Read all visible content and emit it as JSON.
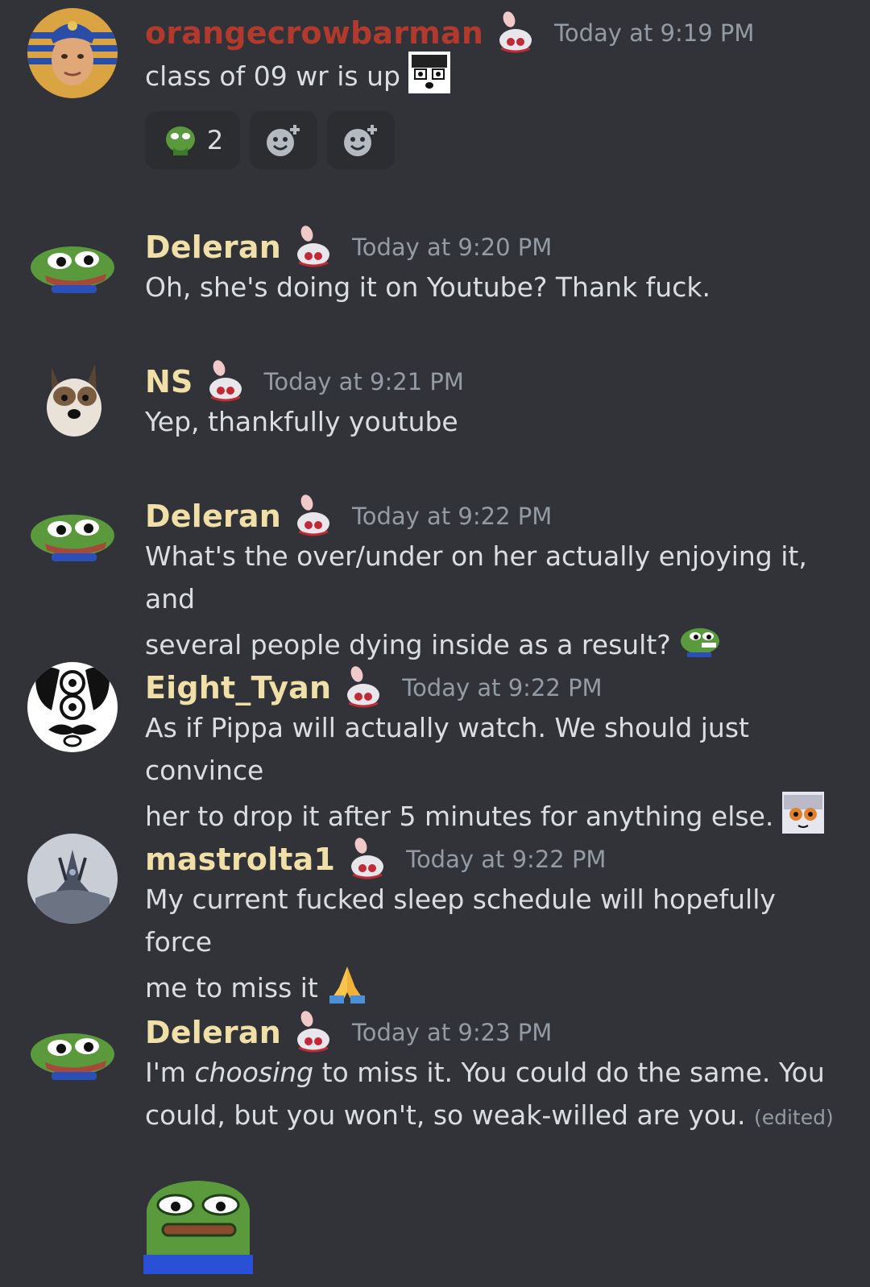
{
  "colors": {
    "background": "#313338",
    "username_orange": "#b23a2c",
    "username_gold": "#f0dfa6",
    "timestamp": "#949ba4",
    "message_text": "#dbdee1",
    "reaction_bg": "#2b2d31"
  },
  "messages": [
    {
      "username": "orangecrowbarman",
      "username_color": "#b23a2c",
      "timestamp": "Today at 9:19 PM",
      "avatar": "pharaoh-avatar",
      "text": "class of 09 wr is up",
      "inline_emoji": "anime-shocked-emoji",
      "reactions": [
        {
          "icon": "pepe-sick-emoji",
          "count": "2"
        },
        {
          "icon": "add-super-reaction-icon"
        },
        {
          "icon": "add-reaction-icon"
        }
      ]
    },
    {
      "username": "Deleran",
      "timestamp": "Today at 9:20 PM",
      "avatar": "pepe-avatar",
      "text": "Oh, she's doing it on Youtube?  Thank fuck."
    },
    {
      "username": "NS",
      "timestamp": "Today at 9:21 PM",
      "avatar": "dog-avatar",
      "text": "Yep, thankfully youtube"
    },
    {
      "username": "Deleran",
      "timestamp": "Today at 9:22 PM",
      "avatar": "pepe-avatar",
      "line1": "What's the over/under on her actually enjoying it, and",
      "line2": "several people dying inside as a result?",
      "inline_emoji": "pepe-grin-emoji"
    },
    {
      "username": "Eight_Tyan",
      "timestamp": "Today at 9:22 PM",
      "avatar": "cartoon-face-avatar",
      "line1": "As if Pippa will actually watch. We should just convince",
      "line2": "her to drop it after 5 minutes for anything else.",
      "inline_emoji": "anime-girl-emoji"
    },
    {
      "username": "mastrolta1",
      "timestamp": "Today at 9:22 PM",
      "avatar": "dragon-avatar",
      "line1": "My current fucked sleep schedule will hopefully force",
      "line2": "me to miss it",
      "inline_emoji": "folded-hands-emoji"
    },
    {
      "username": "Deleran",
      "timestamp": "Today at 9:23 PM",
      "avatar": "pepe-avatar",
      "line1_a": "I'm ",
      "line1_em": "choosing",
      "line1_b": " to miss it.  You could do the same.  You",
      "line2": "could, but you won't, so weak-willed are you.",
      "edited": "(edited)",
      "attachment_emoji": "pepe-stare-emoji"
    }
  ],
  "role_badge": "bunny-role-badge"
}
